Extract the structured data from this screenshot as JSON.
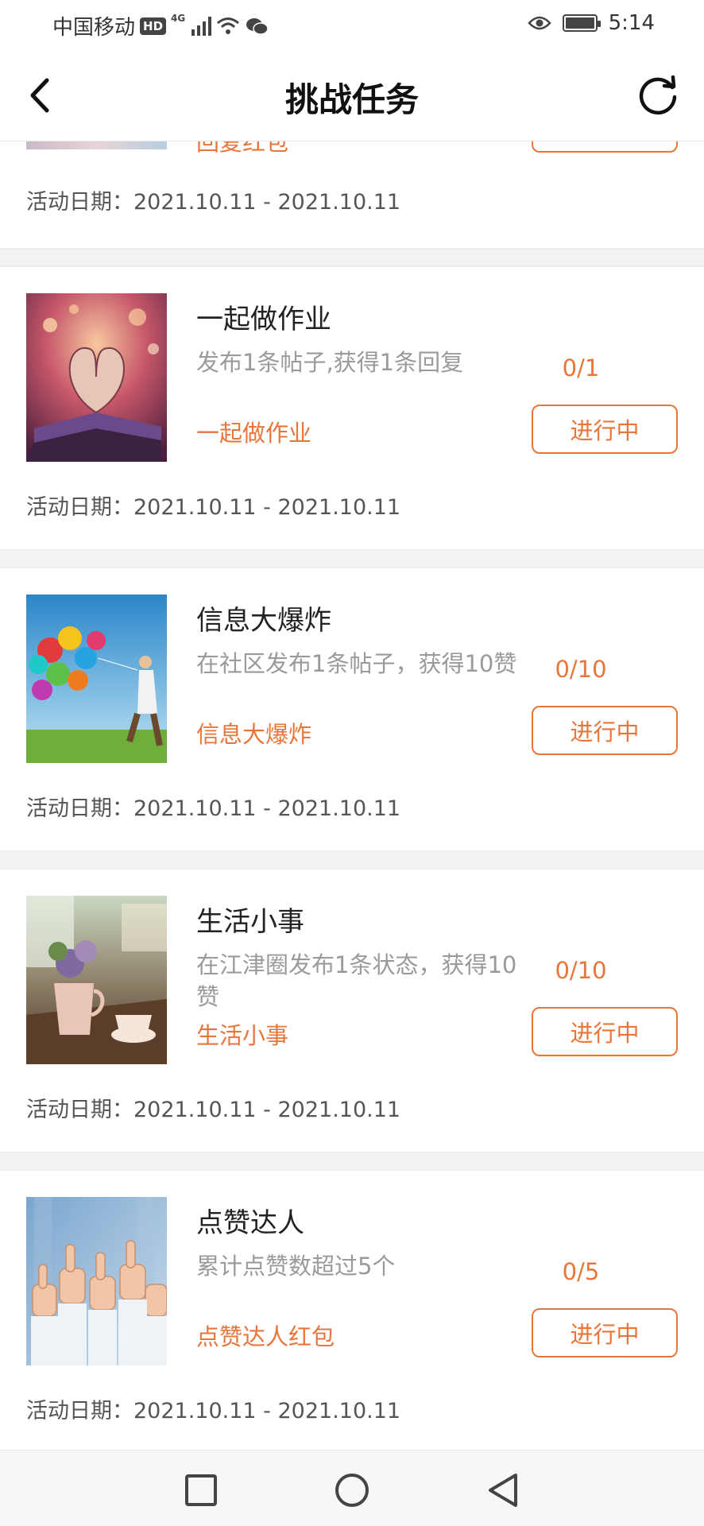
{
  "status_bar": {
    "carrier": "中国移动",
    "hd_badge": "HD",
    "network": "4G",
    "time": "5:14"
  },
  "header": {
    "title": "挑战任务"
  },
  "partial_card": {
    "reward": "回复红包",
    "date": "活动日期：2021.10.11 - 2021.10.11"
  },
  "cards": [
    {
      "title": "一起做作业",
      "description": "发布1条帖子,获得1条回复",
      "reward": "一起做作业",
      "progress": "0/1",
      "button": "进行中",
      "date": "活动日期：2021.10.11 - 2021.10.11"
    },
    {
      "title": "信息大爆炸",
      "description": "在社区发布1条帖子，获得10赞",
      "reward": "信息大爆炸",
      "progress": "0/10",
      "button": "进行中",
      "date": "活动日期：2021.10.11 - 2021.10.11"
    },
    {
      "title": "生活小事",
      "description": "在江津圈发布1条状态，获得10赞",
      "reward": "生活小事",
      "progress": "0/10",
      "button": "进行中",
      "date": "活动日期：2021.10.11 - 2021.10.11"
    },
    {
      "title": "点赞达人",
      "description": "累计点赞数超过5个",
      "reward": "点赞达人红包",
      "progress": "0/5",
      "button": "进行中",
      "date": "活动日期：2021.10.11 - 2021.10.11"
    }
  ],
  "colors": {
    "accent": "#e8763b",
    "muted_text": "#9a9a9a",
    "divider": "#f2f2f2"
  }
}
